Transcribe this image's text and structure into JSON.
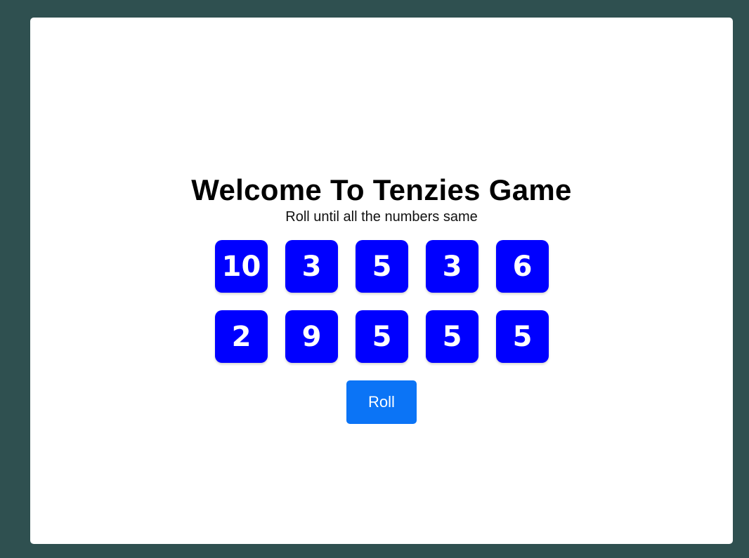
{
  "title": "Welcome To Tenzies Game",
  "subtitle": "Roll until all the numbers same",
  "dice": [
    {
      "value": "10"
    },
    {
      "value": "3"
    },
    {
      "value": "5"
    },
    {
      "value": "3"
    },
    {
      "value": "6"
    },
    {
      "value": "2"
    },
    {
      "value": "9"
    },
    {
      "value": "5"
    },
    {
      "value": "5"
    },
    {
      "value": "5"
    }
  ],
  "roll_button_label": "Roll",
  "colors": {
    "background": "#2f5050",
    "card": "#ffffff",
    "die": "#0000ff",
    "die_text": "#ffffff",
    "button": "#0b74f6"
  }
}
